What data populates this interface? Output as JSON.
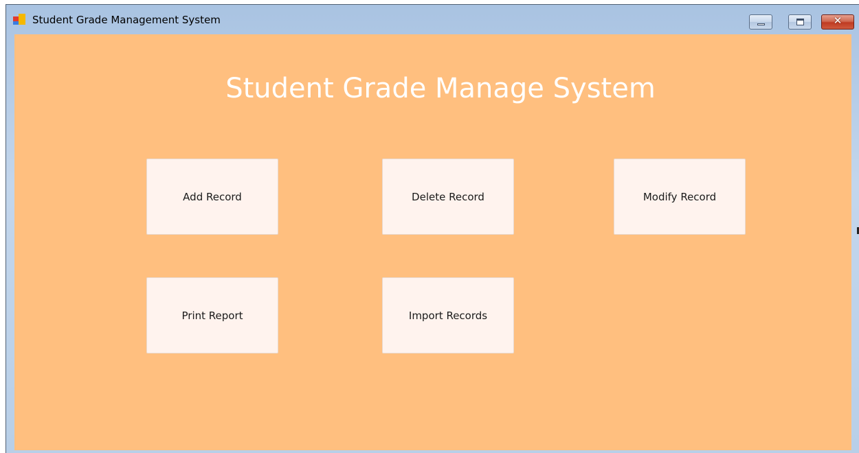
{
  "window": {
    "title": "Student Grade Management System",
    "icon": "app-window-icon",
    "controls": {
      "minimize_icon": "minimize-icon",
      "maximize_icon": "maximize-icon",
      "close_label": "✕"
    }
  },
  "form": {
    "background_color": "#ffbf7f",
    "title": "Student Grade Manage System",
    "buttons": {
      "add": "Add Record",
      "delete": "Delete Record",
      "modify": "Modify Record",
      "print": "Print Report",
      "import": "Import Records"
    }
  }
}
